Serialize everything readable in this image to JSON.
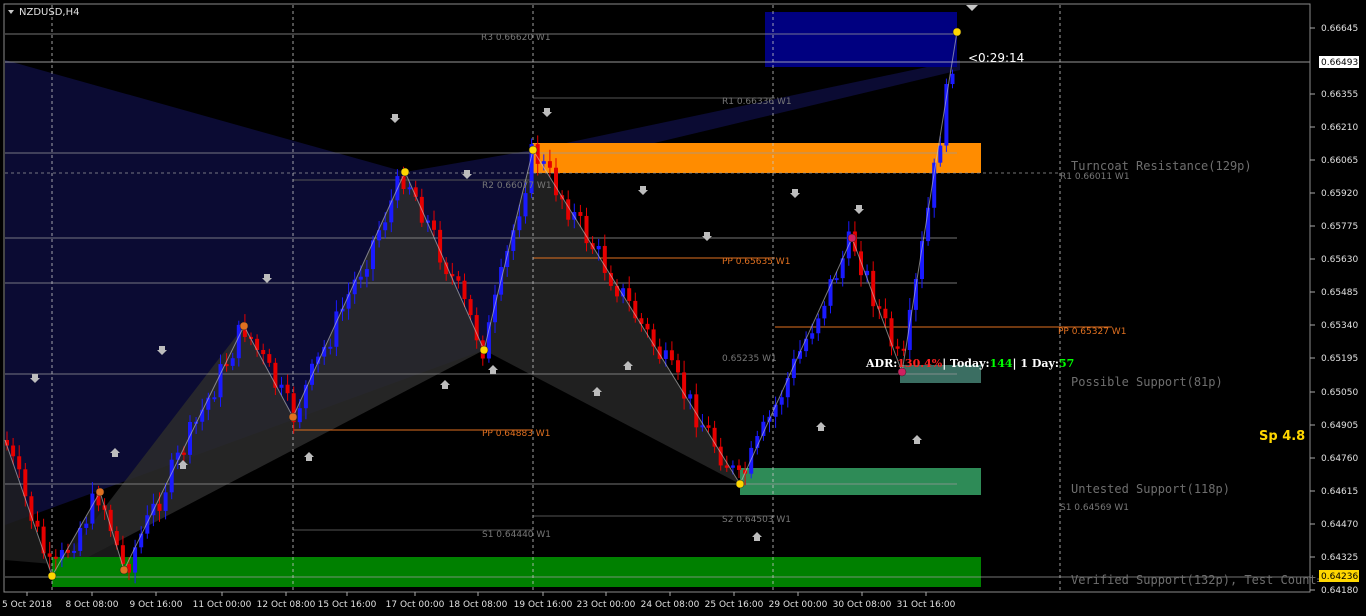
{
  "window": {
    "symbol_label": "NZDUSD,H4"
  },
  "timer": "<0:29:14",
  "spread": "Sp 4.8",
  "adr": {
    "label": "ADR:",
    "value": "130.4%",
    "sep1": "| Today:",
    "today": "144",
    "sep2": "| 1 Day:",
    "day": "57"
  },
  "price_axis": {
    "ticks": [
      "0.66645",
      "0.66355",
      "0.66210",
      "0.66065",
      "0.65920",
      "0.65775",
      "0.65630",
      "0.65485",
      "0.65340",
      "0.65195",
      "0.65050",
      "0.64905",
      "0.64760",
      "0.64615",
      "0.64470",
      "0.64325",
      "0.64180"
    ],
    "current_bid": "0.66493",
    "marker_low": "0.64236"
  },
  "time_axis": {
    "labels": [
      "5 Oct 2018",
      "8 Oct 08:00",
      "9 Oct 16:00",
      "11 Oct 00:00",
      "12 Oct 08:00",
      "15 Oct 16:00",
      "17 Oct 00:00",
      "18 Oct 08:00",
      "19 Oct 16:00",
      "23 Oct 00:00",
      "24 Oct 08:00",
      "25 Oct 16:00",
      "29 Oct 00:00",
      "30 Oct 08:00",
      "31 Oct 16:00"
    ]
  },
  "zones": {
    "resistance": "Turncoat Resistance(129p)",
    "possible_support": "Possible Support(81p)",
    "untested_support": "Untested Support(118p)",
    "verified_support": "Verified Support(132p), Test Count="
  },
  "levels": {
    "r3": "R3 0.66620 W1",
    "r2": "R2 0.66077 W1",
    "r1": "R1 0.66336 W1",
    "r1b": "R1 0.66011 W1",
    "pp_mid": "PP 0.65635 W1",
    "pp_right": "PP 0.65327 W1",
    "pp_left": "PP 0.64883 W1",
    "s1": "S1 0.64440 W1",
    "s2": "S2 0.64503 W1",
    "s1b": "S1 0.64569 W1",
    "mid_small": "0.65235 W1"
  },
  "colors": {
    "bull": "#1a1aff",
    "bear": "#e60000",
    "resistance_zone": "#ff8c00",
    "verified_zone": "#008000",
    "untested_zone": "#2e8b57",
    "top_zone": "#000080",
    "grid": "#9a9a9a",
    "pivot_line": "#e07020"
  }
}
